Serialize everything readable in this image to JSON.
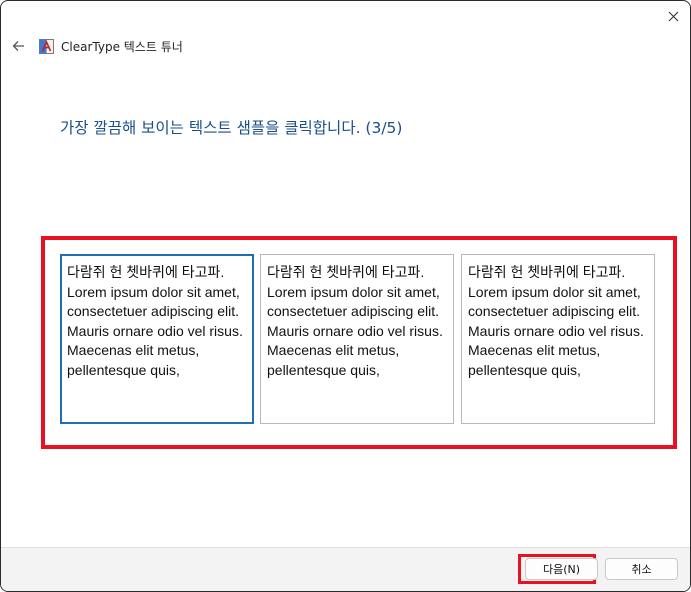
{
  "window": {
    "title": "ClearType 텍스트 튜너"
  },
  "instruction": "가장 깔끔해 보이는 텍스트 샘플을 클릭합니다. (3/5)",
  "samples": [
    {
      "text": "다람쥐 헌 쳇바퀴에 타고파. Lorem ipsum dolor sit amet, consectetuer adipiscing elit. Mauris ornare odio vel risus. Maecenas elit metus, pellentesque quis,",
      "selected": true
    },
    {
      "text": "다람쥐 헌 쳇바퀴에 타고파. Lorem ipsum dolor sit amet, consectetuer adipiscing elit. Mauris ornare odio vel risus. Maecenas elit metus, pellentesque quis,",
      "selected": false
    },
    {
      "text": "다람쥐 헌 쳇바퀴에 타고파. Lorem ipsum dolor sit amet, consectetuer adipiscing elit. Mauris ornare odio vel risus. Maecenas elit metus, pellentesque quis,",
      "selected": false
    }
  ],
  "buttons": {
    "next_label": "다음(N)",
    "cancel_label": "취소"
  },
  "icons": {
    "back": "back-arrow-icon",
    "close": "close-icon",
    "app": "cleartype-app-icon"
  },
  "colors": {
    "accent": "#1e6fb5",
    "instruction_text": "#1a4f8a",
    "highlight": "#e81123"
  }
}
